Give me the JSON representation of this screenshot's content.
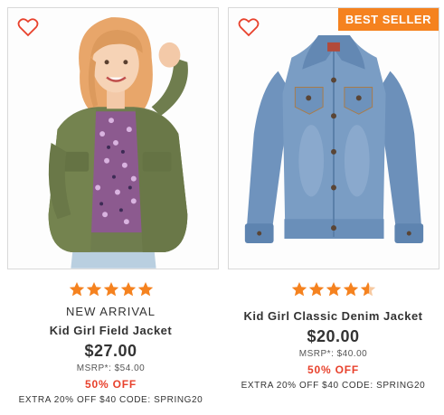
{
  "products": [
    {
      "badge": "",
      "rating": 5,
      "tag": "NEW ARRIVAL",
      "name": "Kid Girl Field Jacket",
      "price": "$27.00",
      "msrp": "MSRP*: $54.00",
      "discount": "50% OFF",
      "promo": "EXTRA 20% OFF $40 CODE: SPRING20",
      "image": "girl-in-green-field-jacket"
    },
    {
      "badge": "BEST SELLER",
      "rating": 4.5,
      "tag": "",
      "name": "Kid Girl Classic Denim Jacket",
      "price": "$20.00",
      "msrp": "MSRP*: $40.00",
      "discount": "50% OFF",
      "promo": "EXTRA 20% OFF $40 CODE: SPRING20",
      "image": "denim-jacket"
    }
  ],
  "colors": {
    "star": "#f5821f",
    "badge": "#f5821f",
    "heart": "#e8412c",
    "discount": "#e8412c"
  }
}
